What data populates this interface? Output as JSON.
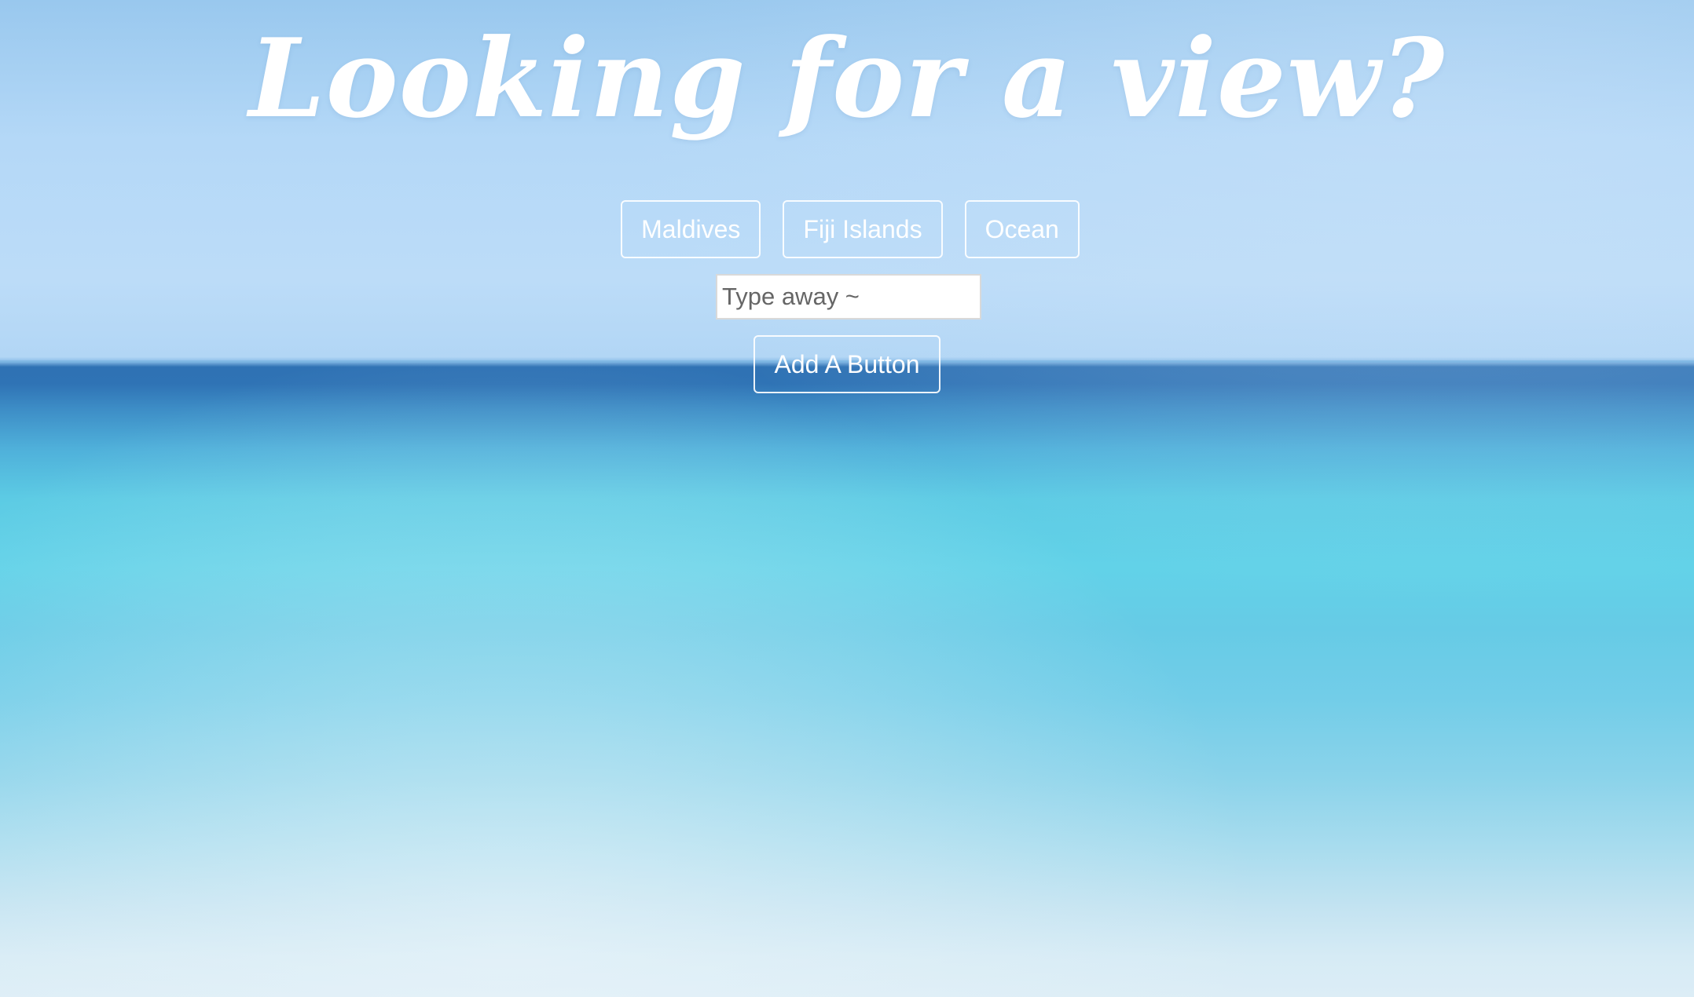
{
  "title": "Looking for a view?",
  "view_buttons": [
    {
      "label": "Maldives"
    },
    {
      "label": "Fiji Islands"
    },
    {
      "label": "Ocean"
    }
  ],
  "search": {
    "value": "",
    "placeholder": "Type away ~"
  },
  "add_button": {
    "label": "Add A Button"
  },
  "colors": {
    "text": "#ffffff",
    "sky": "#b4d8f7",
    "sea": "#5ccbe4",
    "horizon": "#2f72b4"
  }
}
